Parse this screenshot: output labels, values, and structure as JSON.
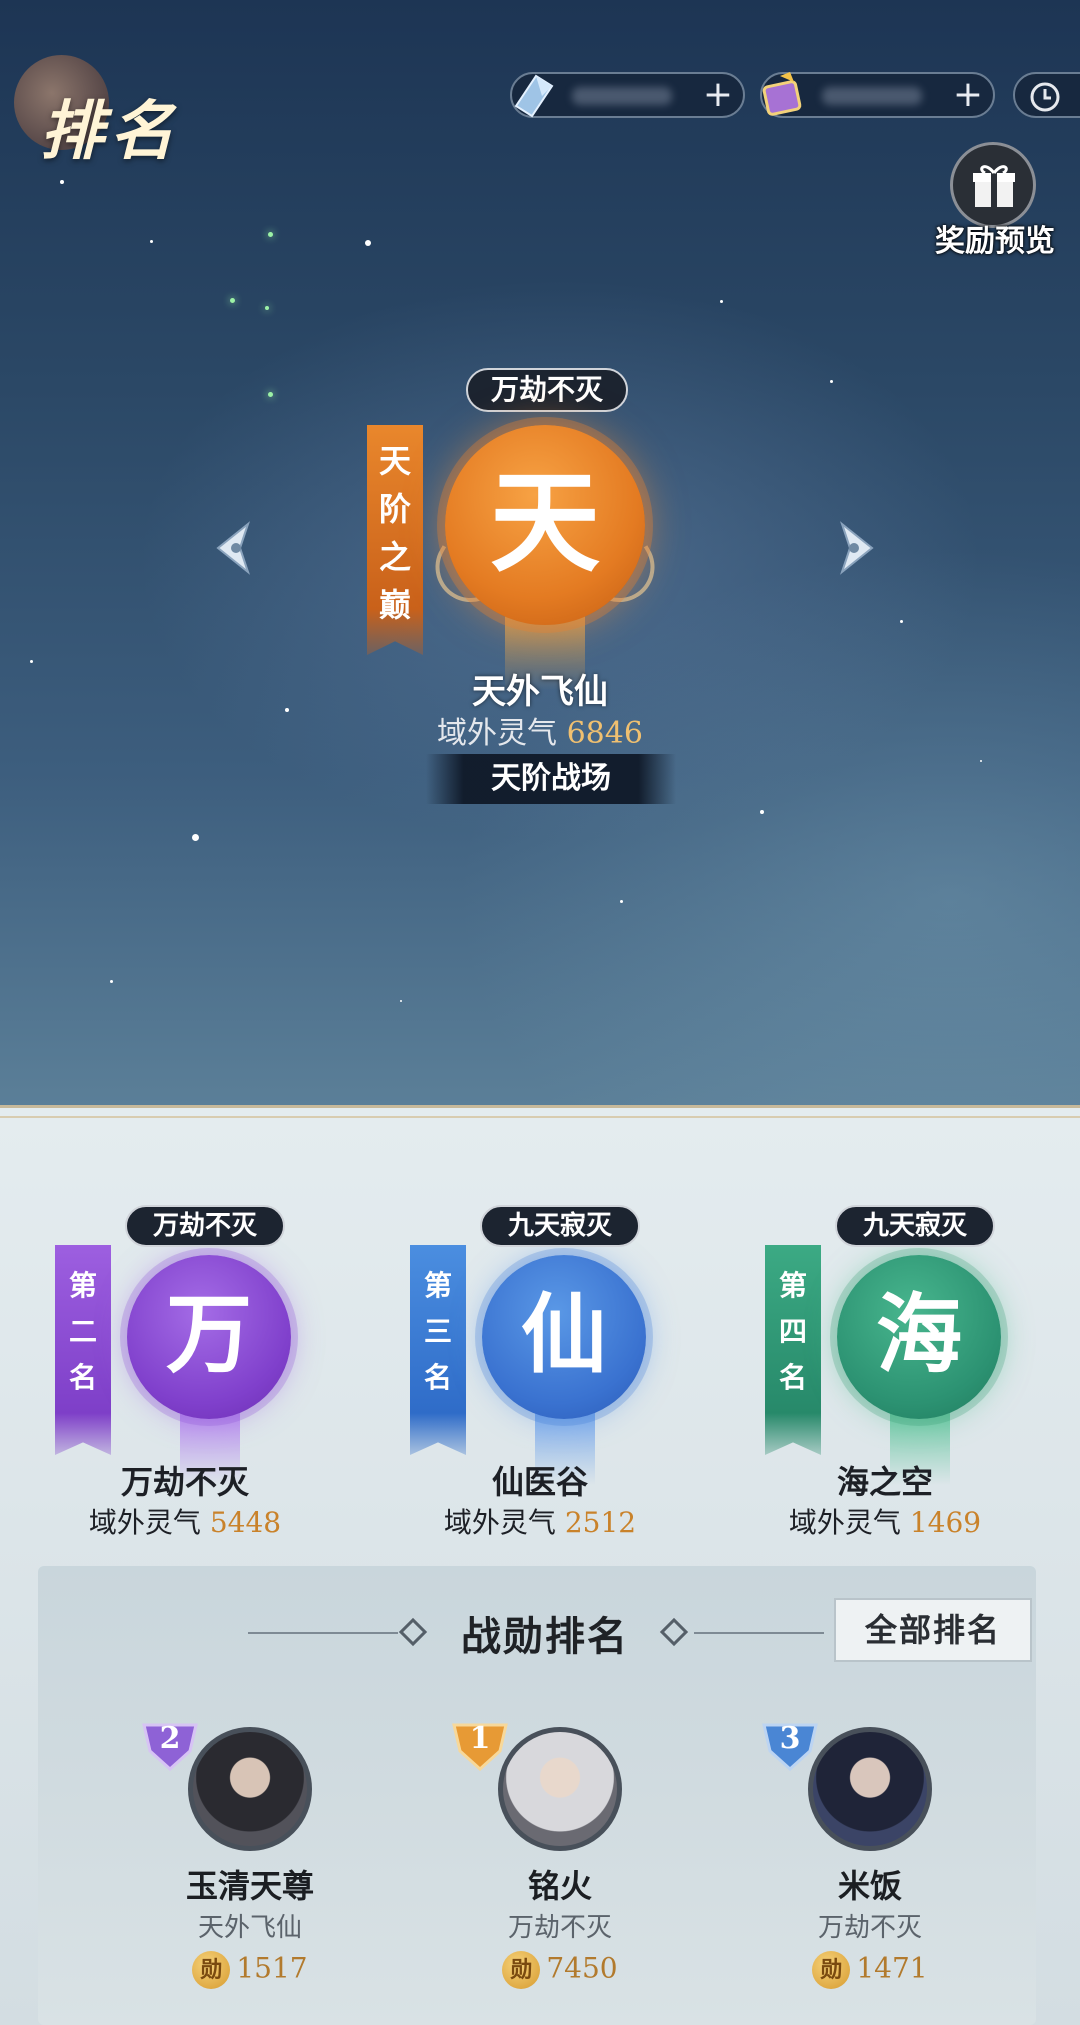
{
  "header": {
    "title": "排名",
    "reward_preview_label": "奖励预览",
    "resources": [
      {
        "icon": "crystal-icon",
        "plus": "+"
      },
      {
        "icon": "ticket-icon",
        "plus": "+"
      }
    ]
  },
  "top_emblem": {
    "tag": "万劫不灭",
    "tier_banner": "天阶之巅",
    "orb_char": "天",
    "name": "天外飞仙",
    "score_label": "域外灵气",
    "score_value": "6846",
    "arena_button": "天阶战场",
    "color": "#e47b22"
  },
  "rankings": [
    {
      "tag": "万劫不灭",
      "banner": "第二名",
      "orb_char": "万",
      "name": "万劫不灭",
      "score_label": "域外灵气",
      "score_value": "5448",
      "color": "#8c4ed8"
    },
    {
      "tag": "九天寂灭",
      "banner": "第三名",
      "orb_char": "仙",
      "name": "仙医谷",
      "score_label": "域外灵气",
      "score_value": "2512",
      "color": "#3c7bd6"
    },
    {
      "tag": "九天寂灭",
      "banner": "第四名",
      "orb_char": "海",
      "name": "海之空",
      "score_label": "域外灵气",
      "score_value": "1469",
      "color": "#2e9a78"
    }
  ],
  "merit": {
    "title": "战勋排名",
    "all_button": "全部排名",
    "coin_char": "勋",
    "players": [
      {
        "rank": "2",
        "name": "玉清天尊",
        "sect": "天外飞仙",
        "score": "1517",
        "badge_color": "#8e62d6"
      },
      {
        "rank": "1",
        "name": "铭火",
        "sect": "万劫不灭",
        "score": "7450",
        "badge_color": "#e79a35"
      },
      {
        "rank": "3",
        "name": "米饭",
        "sect": "万劫不灭",
        "score": "1471",
        "badge_color": "#4a86d4"
      }
    ]
  }
}
